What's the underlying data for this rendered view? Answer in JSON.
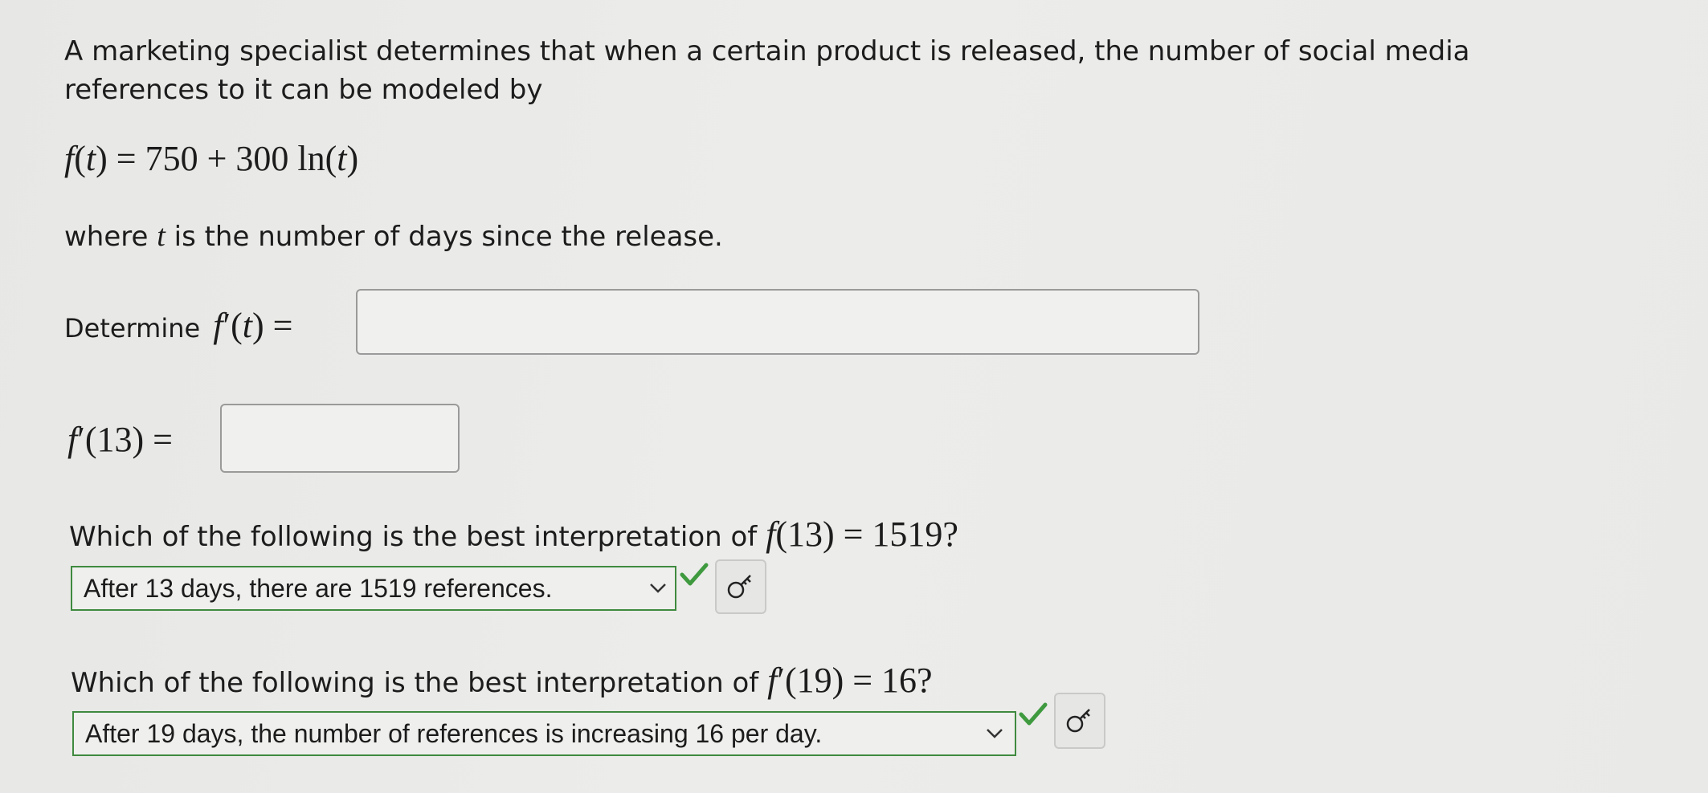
{
  "problem": {
    "intro_line1": "A marketing specialist determines that when a certain product is released, the number of social media",
    "intro_line2": "references to it can be modeled by",
    "formula": "= 750 + 300 ln(",
    "where_prefix": "where",
    "where_suffix": "is the number of days since the release."
  },
  "derivative": {
    "label": "Determine",
    "input_value": ""
  },
  "derivative_at_13": {
    "label": "′(13) =",
    "input_value": ""
  },
  "question1": {
    "prefix": "Which of the following is the best interpretation of",
    "expr": "(13) = 1519?",
    "selected": "After 13 days, there are 1519 references."
  },
  "question2": {
    "prefix": "Which of the following is the best interpretation of",
    "expr": "′(19) = 16?",
    "selected": "After 19 days, the number of references is increasing 16 per day."
  },
  "colors": {
    "correct_green": "#3f9a3f",
    "border_green": "#3f8a3f"
  },
  "icons": {
    "correct": "checkmark-icon",
    "hint": "key-icon"
  }
}
